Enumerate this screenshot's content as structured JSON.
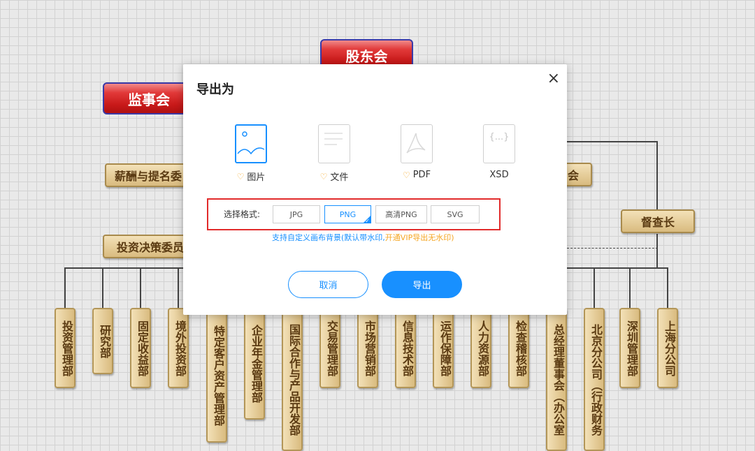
{
  "chart": {
    "top_boxes": {
      "shareholders": "股东会",
      "supervisors": "监事会"
    },
    "committees": {
      "compensation": "薪酬与提名委",
      "investment": "投资决策委员",
      "right_committee": "会",
      "inspector": "督查长"
    },
    "departments": [
      "投资管理部",
      "研究部",
      "固定收益部",
      "境外投资部",
      "特定客户资产管理部",
      "企业年金管理部",
      "国际合作与产品开发部",
      "交易管理部",
      "市场营销部",
      "信息技术部",
      "运作保障部",
      "人力资源部",
      "检查稽核部",
      "总经理董事会（办公室",
      "北京分公司（行政财务",
      "深圳管理部",
      "上海分公司"
    ]
  },
  "dialog": {
    "title": "导出为",
    "close": "×",
    "options": [
      {
        "label": "图片",
        "icon": "image-file-icon",
        "vip": true,
        "selected": true
      },
      {
        "label": "文件",
        "icon": "text-file-icon",
        "vip": true,
        "selected": false
      },
      {
        "label": "PDF",
        "icon": "pdf-file-icon",
        "vip": true,
        "selected": false
      },
      {
        "label": "XSD",
        "icon": "xsd-file-icon",
        "vip": false,
        "selected": false
      }
    ],
    "format_label": "选择格式:",
    "formats": [
      "JPG",
      "PNG",
      "高清PNG",
      "SVG"
    ],
    "selected_format": "PNG",
    "hint_main": "支持自定义画布背景(默认带水印,",
    "hint_vip": "开通VIP导出无水印)",
    "cancel": "取消",
    "export": "导出"
  },
  "colors": {
    "accent": "#1890ff",
    "vip": "#f5a623",
    "highlight": "#e22b2b"
  }
}
